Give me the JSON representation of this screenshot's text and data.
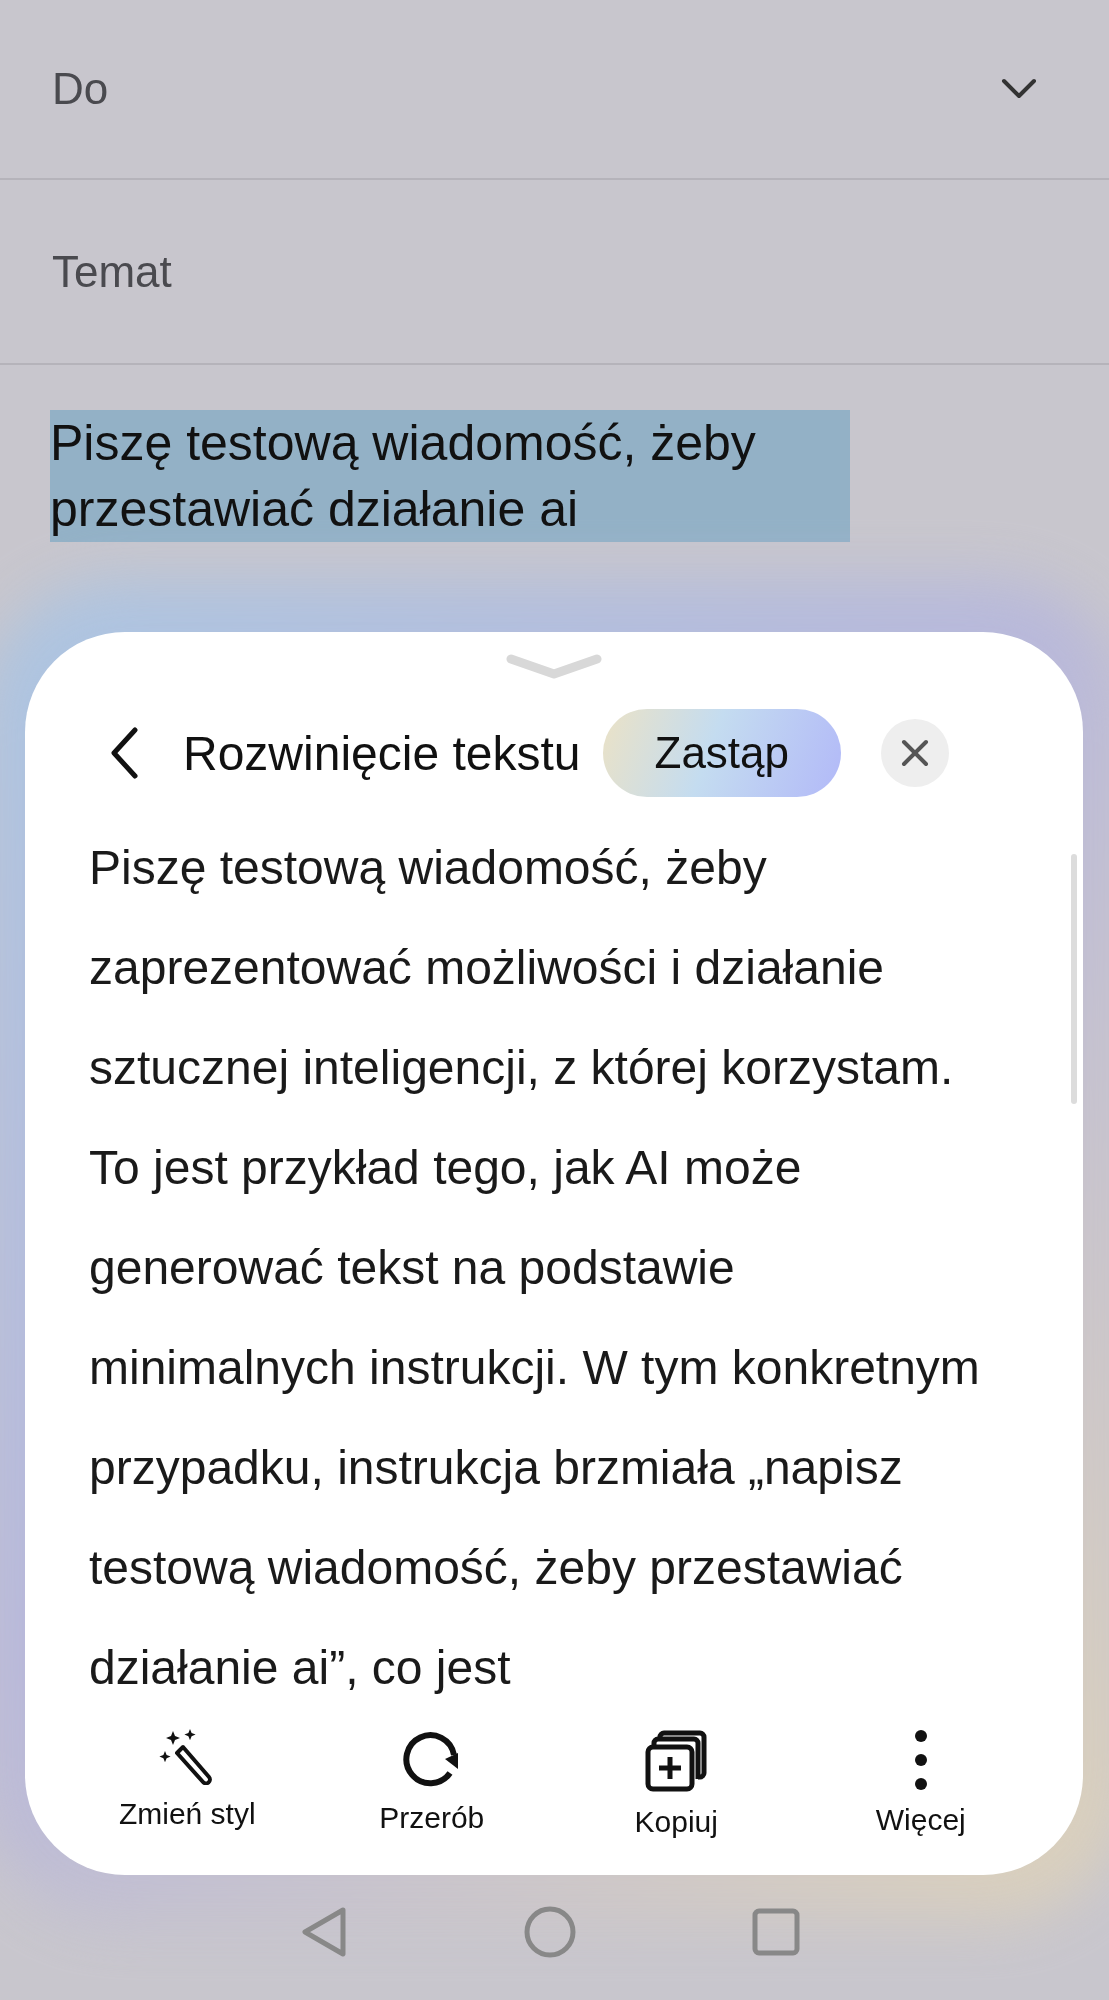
{
  "email": {
    "to_label": "Do",
    "subject_label": "Temat",
    "selected_text": "Piszę testową wiadomość, żeby przestawiać działanie ai"
  },
  "sheet": {
    "title": "Rozwinięcie tekstu",
    "replace_button": "Zastąp",
    "result_text": "Piszę testową wiadomość, żeby zaprezentować możliwości i działanie sztucznej inteligencji, z której korzystam. To jest przykład tego, jak AI może generować tekst na podstawie minimalnych instrukcji. W tym konkretnym przypadku, instrukcja brzmiała „napisz testową wiadomość, żeby przestawiać działanie ai”, co jest",
    "actions": [
      {
        "kind": "style",
        "label": "Zmień styl"
      },
      {
        "kind": "redo",
        "label": "Przerób"
      },
      {
        "kind": "copy",
        "label": "Kopiuj"
      },
      {
        "kind": "more",
        "label": "Więcej"
      }
    ]
  }
}
